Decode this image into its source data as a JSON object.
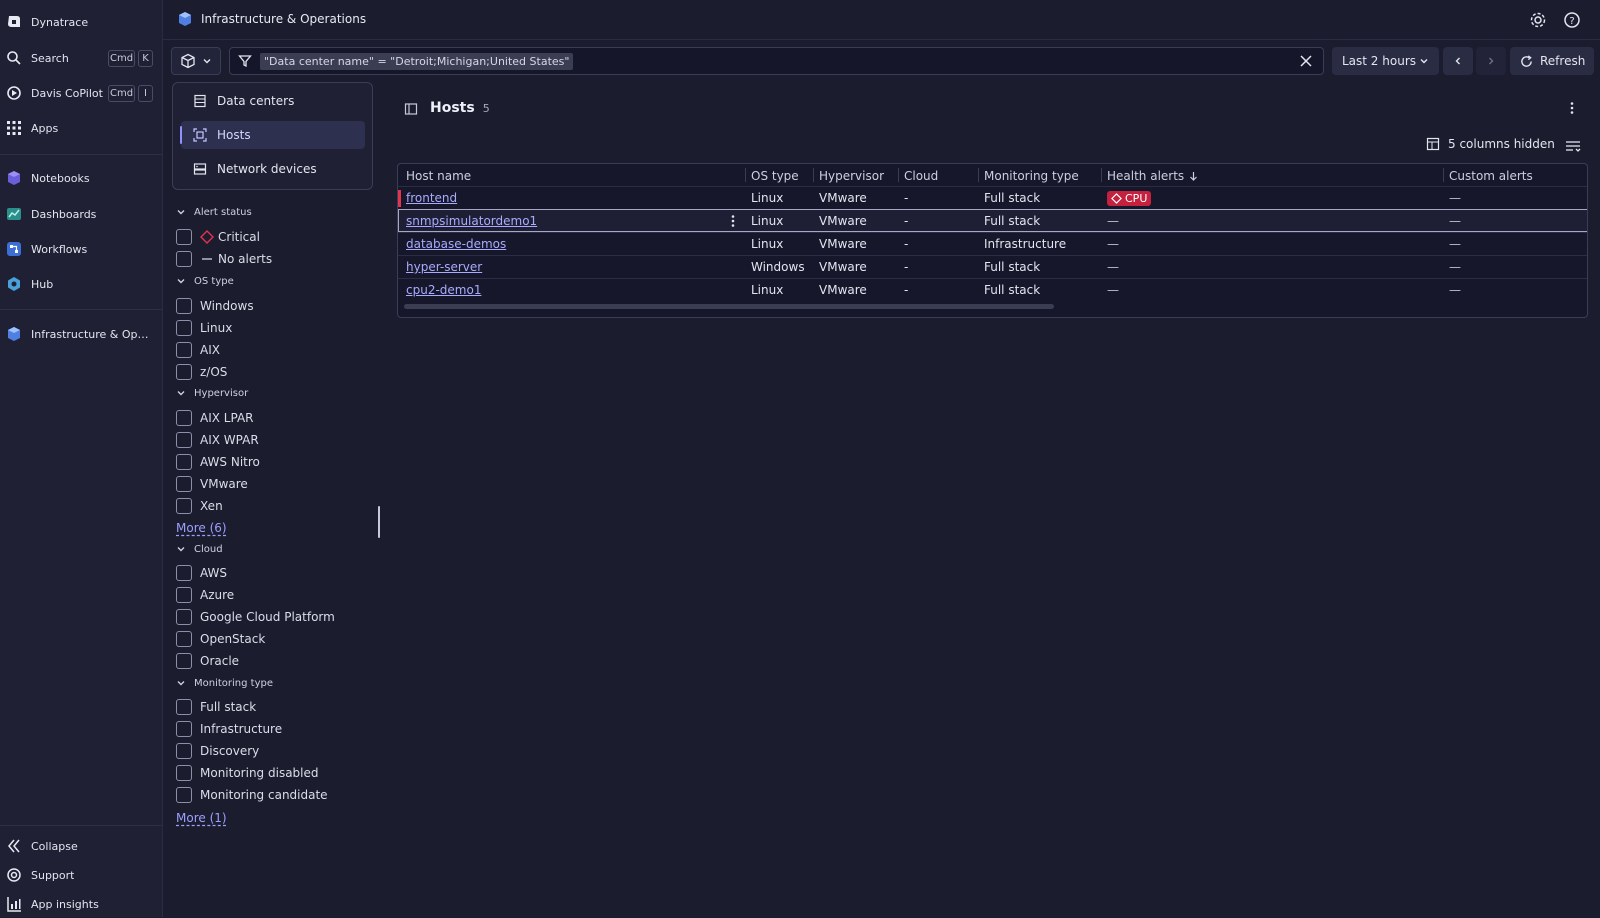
{
  "nav": {
    "items": [
      {
        "label": "Dynatrace",
        "icon": "dynatrace-logo-icon"
      },
      {
        "label": "Search",
        "icon": "search-icon",
        "kbd1": "Cmd",
        "kbd2": "K"
      },
      {
        "label": "Davis CoPilot",
        "icon": "copilot-icon",
        "kbd1": "Cmd",
        "kbd2": "I"
      },
      {
        "label": "Apps",
        "icon": "apps-grid-icon"
      },
      {
        "label": "Notebooks",
        "icon": "notebooks-icon"
      },
      {
        "label": "Dashboards",
        "icon": "dashboards-icon"
      },
      {
        "label": "Workflows",
        "icon": "workflows-icon"
      },
      {
        "label": "Hub",
        "icon": "hub-icon"
      },
      {
        "label": "Infrastructure & Operati...",
        "icon": "infrastructure-app-icon"
      }
    ],
    "bottom": [
      {
        "label": "Collapse",
        "icon": "collapse-icon"
      },
      {
        "label": "Support",
        "icon": "support-icon"
      },
      {
        "label": "App insights",
        "icon": "app-insights-icon"
      }
    ]
  },
  "header": {
    "app_title": "Infrastructure & Operations"
  },
  "toolbar": {
    "filter_text": "\"Data center name\" = \"Detroit;Michigan;United States\"",
    "timeframe": "Last 2 hours",
    "refresh": "Refresh"
  },
  "categories": [
    {
      "label": "Data centers",
      "icon": "datacenter-icon"
    },
    {
      "label": "Hosts",
      "icon": "host-icon",
      "active": true
    },
    {
      "label": "Network devices",
      "icon": "network-device-icon"
    }
  ],
  "filters": {
    "alert_status": {
      "title": "Alert status",
      "options": [
        "Critical",
        "No alerts"
      ]
    },
    "os_type": {
      "title": "OS type",
      "options": [
        "Windows",
        "Linux",
        "AIX",
        "z/OS"
      ]
    },
    "hypervisor": {
      "title": "Hypervisor",
      "options": [
        "AIX LPAR",
        "AIX WPAR",
        "AWS Nitro",
        "VMware",
        "Xen"
      ],
      "more": "More (6)"
    },
    "cloud": {
      "title": "Cloud",
      "options": [
        "AWS",
        "Azure",
        "Google Cloud Platform",
        "OpenStack",
        "Oracle"
      ]
    },
    "monitoring_type": {
      "title": "Monitoring type",
      "options": [
        "Full stack",
        "Infrastructure",
        "Discovery",
        "Monitoring disabled",
        "Monitoring candidate"
      ],
      "more": "More (1)"
    }
  },
  "main": {
    "title": "Hosts",
    "count": "5",
    "columns_hidden": "5 columns hidden"
  },
  "table": {
    "columns": [
      "Host name",
      "OS type",
      "Hypervisor",
      "Cloud",
      "Monitoring type",
      "Health alerts",
      "Custom alerts"
    ],
    "rows": [
      {
        "host": "frontend",
        "os": "Linux",
        "hypervisor": "VMware",
        "cloud": "-",
        "monitoring": "Full stack",
        "health": "CPU",
        "custom": "—",
        "critical": true
      },
      {
        "host": "snmpsimulatordemo1",
        "os": "Linux",
        "hypervisor": "VMware",
        "cloud": "-",
        "monitoring": "Full stack",
        "health": "—",
        "custom": "—",
        "selected": true
      },
      {
        "host": "database-demos",
        "os": "Linux",
        "hypervisor": "VMware",
        "cloud": "-",
        "monitoring": "Infrastructure",
        "health": "—",
        "custom": "—"
      },
      {
        "host": "hyper-server",
        "os": "Windows",
        "hypervisor": "VMware",
        "cloud": "-",
        "monitoring": "Full stack",
        "health": "—",
        "custom": "—"
      },
      {
        "host": "cpu2-demo1",
        "os": "Linux",
        "hypervisor": "VMware",
        "cloud": "-",
        "monitoring": "Full stack",
        "health": "—",
        "custom": "—"
      }
    ]
  },
  "colors": {
    "background": "#1b1c2e",
    "accent": "#9d9fff",
    "critical": "#c4213f"
  }
}
